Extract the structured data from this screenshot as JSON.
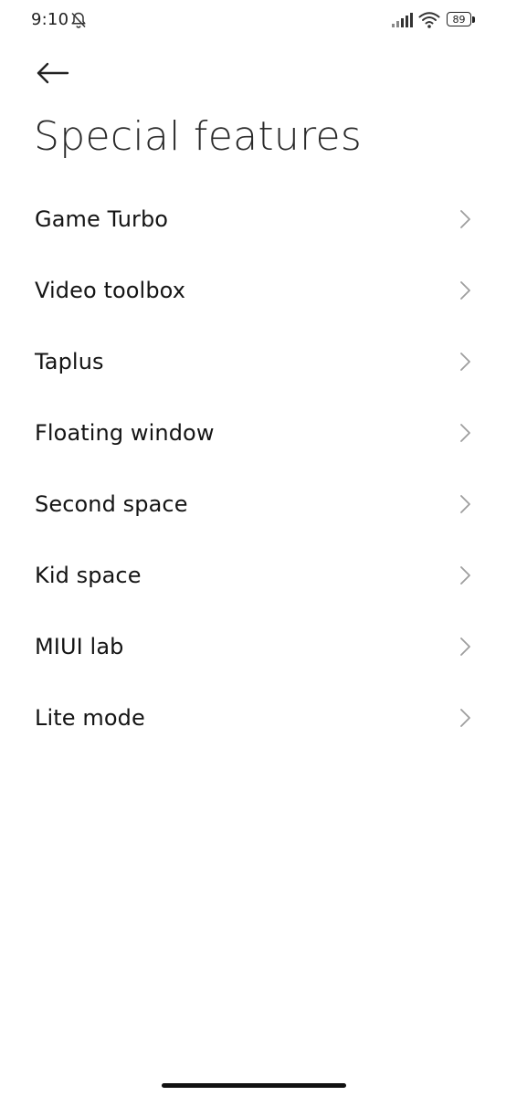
{
  "status_bar": {
    "time": "9:10",
    "battery_level": "89",
    "icons": [
      "bell-off-icon",
      "signal-icon",
      "wifi-icon",
      "battery-icon"
    ]
  },
  "header": {
    "back_icon": "arrow-left-icon",
    "title": "Special features"
  },
  "features": {
    "items": [
      {
        "label": "Game Turbo"
      },
      {
        "label": "Video toolbox"
      },
      {
        "label": "Taplus"
      },
      {
        "label": "Floating window"
      },
      {
        "label": "Second space"
      },
      {
        "label": "Kid space"
      },
      {
        "label": "MIUI lab"
      },
      {
        "label": "Lite mode"
      }
    ],
    "chevron_icon": "chevron-right-icon"
  },
  "colors": {
    "background": "#ffffff",
    "text": "#141414",
    "chevron": "#9e9e9e"
  }
}
